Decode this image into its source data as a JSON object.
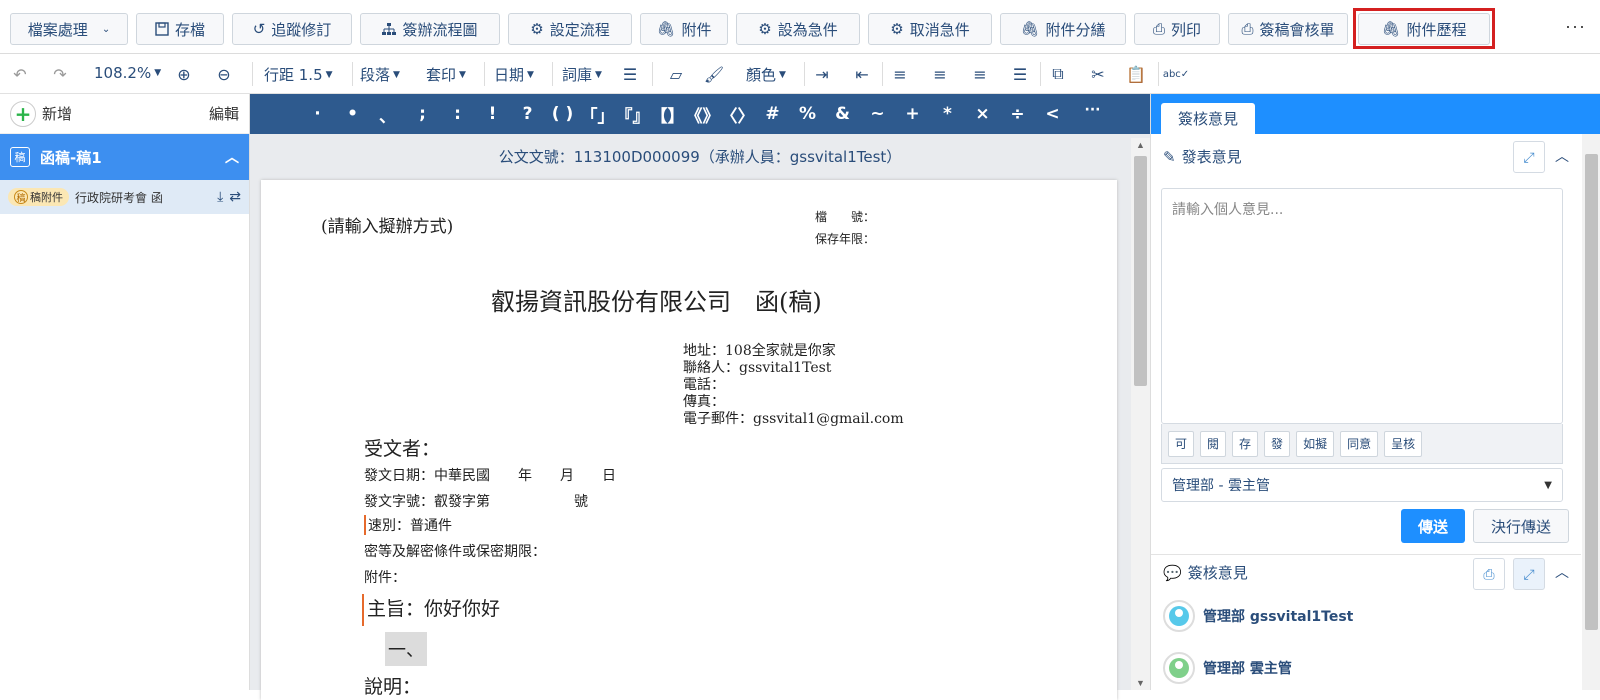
{
  "toolbar": {
    "file_handling": "檔案處理",
    "save": "存檔",
    "track_changes": "追蹤修訂",
    "flowchart": "簽辦流程圖",
    "set_flow": "設定流程",
    "attachment": "附件",
    "set_urgent": "設為急件",
    "cancel_urgent": "取消急件",
    "attachment_split": "附件分繕",
    "print": "列印",
    "sign_form": "簽稿會核單",
    "attachment_history": "附件歷程",
    "more": "···"
  },
  "format": {
    "zoom": "108.2%",
    "line_spacing": "行距 1.5",
    "paragraph": "段落",
    "stamp": "套印",
    "date": "日期",
    "thesaurus": "詞庫",
    "color": "顏色"
  },
  "symbols": [
    "·",
    "•",
    "、",
    ";",
    ":",
    "!",
    "?",
    "( )",
    "「」",
    "『』",
    "【】",
    "《》",
    "〈〉",
    "#",
    "%",
    "&",
    "~",
    "+",
    "*",
    "×",
    "÷",
    "<"
  ],
  "sidebar": {
    "add_label": "新增",
    "edit_label": "編輯",
    "draft_tag": "稿",
    "draft_title": "函稿-稿1",
    "attachment_badge_icon": "稿",
    "attachment_badge": "稿附件",
    "attachment_name": "行政院研考會 函"
  },
  "document": {
    "doc_number_line": "公文文號：113100D000099（承辦人員：gssvital1Test）",
    "method_placeholder": "(請輸入擬辦方式)",
    "file_no_label": "檔　　號：",
    "retention_label": "保存年限：",
    "title": "叡揚資訊股份有限公司　函(稿)",
    "address": "地址：108全家就是你家",
    "contact": "聯絡人：gssvital1Test",
    "phone": "電話：",
    "fax": "傳真：",
    "email": "電子郵件：gssvital1@gmail.com",
    "recipient": "受文者：",
    "issue_date": "發文日期：中華民國　　年　　月　　日",
    "issue_no": "發文字號：叡發字第　　　　　　號",
    "speed": "速別：普通件",
    "secrecy": "密等及解密條件或保密期限：",
    "attachments": "附件：",
    "subject": "主旨：你好你好",
    "item_one": "一、",
    "explanation": "說明："
  },
  "right_panel": {
    "tab": "簽核意見",
    "post_opinion": "發表意見",
    "placeholder": "請輸入個人意見...",
    "quick_phrases": [
      "可",
      "閱",
      "存",
      "發",
      "如擬",
      "同意",
      "呈核"
    ],
    "recipient_select": "管理部 - 雲主管",
    "send": "傳送",
    "final_send": "決行傳送",
    "review_opinions": "簽核意見",
    "reviewers": [
      "管理部 gssvital1Test",
      "管理部 雲主管"
    ]
  }
}
